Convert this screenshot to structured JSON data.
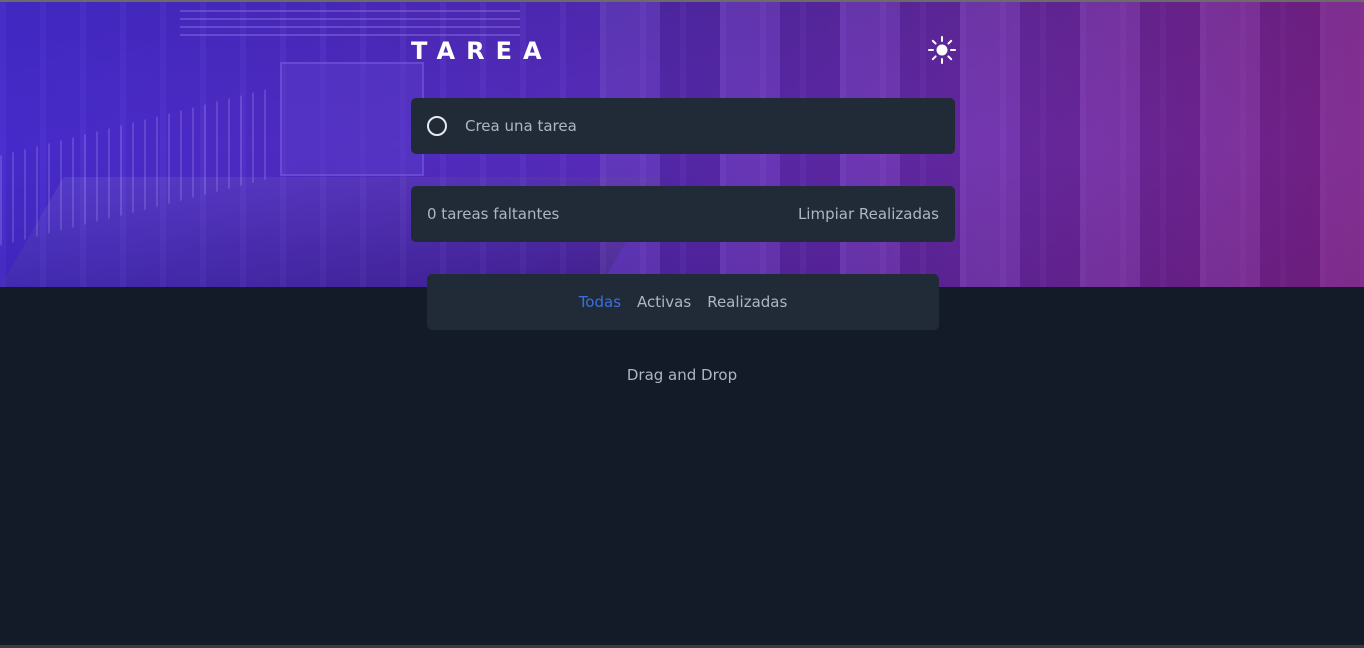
{
  "header": {
    "title": "TAREA",
    "theme_icon": "sun-icon"
  },
  "new_task": {
    "placeholder": "Crea una tarea",
    "value": ""
  },
  "summary": {
    "remaining_text": "0 tareas faltantes",
    "clear_label": "Limpiar Realizadas"
  },
  "filters": {
    "items": [
      {
        "label": "Todas",
        "active": true
      },
      {
        "label": "Activas",
        "active": false
      },
      {
        "label": "Realizadas",
        "active": false
      }
    ]
  },
  "footer_hint": "Drag and Drop",
  "colors": {
    "background": "#131a28",
    "card": "#212b38",
    "text": "#aeb5c3",
    "active_filter": "#3a6fe0",
    "hero_gradient_start": "#4a2fb0",
    "hero_gradient_end": "#8c1e82"
  }
}
